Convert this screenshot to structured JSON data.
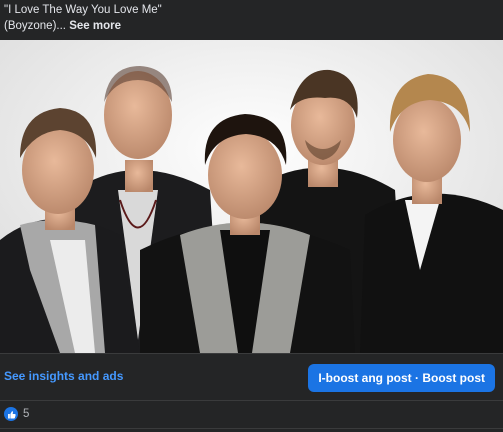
{
  "post": {
    "caption_line1": "\"I Love The Way You Love Me\"",
    "caption_line2": "(Boyzone)...",
    "see_more": "See more"
  },
  "actions": {
    "insights_label": "See insights and ads",
    "boost_label": "I-boost ang post · Boost post"
  },
  "reactions": {
    "icon": "thumbs-up-icon",
    "count": "5"
  },
  "colors": {
    "background": "#242526",
    "link": "#4599ff",
    "primary_button": "#1b74e4",
    "text": "#e4e6eb",
    "secondary_text": "#b0b3b8"
  }
}
